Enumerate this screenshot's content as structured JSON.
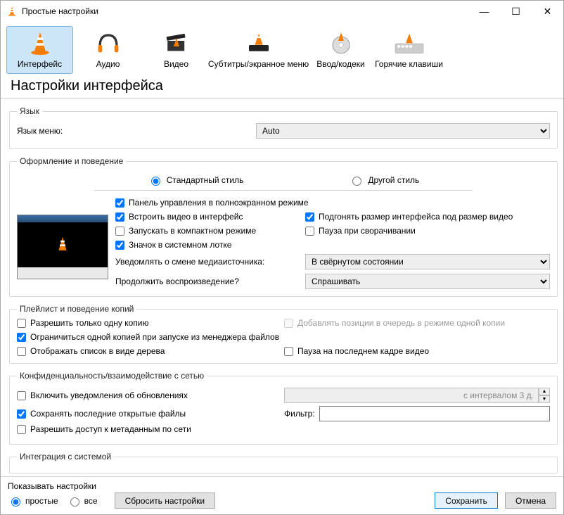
{
  "window": {
    "title": "Простые настройки"
  },
  "tabs": {
    "interface": "Интерфейс",
    "audio": "Аудио",
    "video": "Видео",
    "subtitles": "Субтитры/экранное меню",
    "input": "Ввод/кодеки",
    "hotkeys": "Горячие клавиши"
  },
  "heading": "Настройки интерфейса",
  "lang": {
    "legend": "Язык",
    "label": "Язык меню:",
    "value": "Auto"
  },
  "lookfeel": {
    "legend": "Оформление и поведение",
    "style_native": "Стандартный стиль",
    "style_other": "Другой стиль",
    "fs_controller": "Панель управления в полноэкранном режиме",
    "embed_video": "Встроить видео в интерфейс",
    "resize_iface": "Подгонять размер интерфейса под размер видео",
    "compact": "Запускать в компактном режиме",
    "pause_min": "Пауза при сворачивании",
    "tray": "Значок в системном лотке",
    "notify_label": "Уведомлять о смене медиаисточника:",
    "notify_value": "В свёрнутом состоянии",
    "continue_label": "Продолжить воспроизведение?",
    "continue_value": "Спрашивать"
  },
  "playlist": {
    "legend": "Плейлист и поведение копий",
    "one_instance": "Разрешить только одну копию",
    "enqueue": "Добавлять позиции в очередь в режиме одной копии",
    "one_from_fm": "Ограничиться одной копией при запуске из менеджера файлов",
    "tree": "Отображать список в виде дерева",
    "pause_last": "Пауза на последнем кадре видео"
  },
  "privacy": {
    "legend": "Конфиденциальность/взаимодействие с сетью",
    "updates": "Включить уведомления об обновлениях",
    "interval": "с интервалом 3 д.",
    "save_recent": "Сохранять последние открытые файлы",
    "filter": "Фильтр:",
    "meta_net": "Разрешить доступ к метаданным по сети"
  },
  "sys": {
    "legend": "Интеграция с системой"
  },
  "footer": {
    "show_label": "Показывать настройки",
    "simple": "простые",
    "all": "все",
    "reset": "Сбросить настройки",
    "save": "Сохранить",
    "cancel": "Отмена"
  }
}
